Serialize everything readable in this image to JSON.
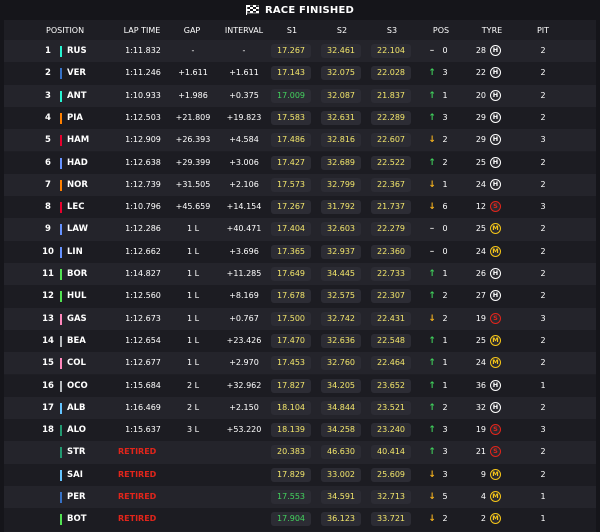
{
  "title": "RACE FINISHED",
  "columns": {
    "position": "POSITION",
    "lap_time": "LAP TIME",
    "gap": "GAP",
    "interval": "INTERVAL",
    "s1": "S1",
    "s2": "S2",
    "s3": "S3",
    "pos": "POS",
    "tyre": "TYRE",
    "pit": "PIT"
  },
  "colors": {
    "mercedes": "#27f4d2",
    "red_bull": "#3671c6",
    "mclaren": "#ff8000",
    "ferrari": "#e8002d",
    "racing_bulls": "#6692ff",
    "haas": "#b6babd",
    "alpine": "#ff87bc",
    "williams": "#64c4ff",
    "sauber": "#52e252",
    "aston_martin": "#229971",
    "sector_yellow": "#f3e66b",
    "sector_green": "#43d35e",
    "retired": "#e1251b"
  },
  "rows": [
    {
      "pos": "1",
      "code": "RUS",
      "team": "mercedes",
      "lap": "1:11.832",
      "gap": "-",
      "int": "-",
      "s1": "17.267",
      "s1c": "y",
      "s2": "32.461",
      "s2c": "y",
      "s3": "22.104",
      "s3c": "y",
      "dir": "flat",
      "chg": "0",
      "laps": "28",
      "tyre": "H",
      "pit": "2"
    },
    {
      "pos": "2",
      "code": "VER",
      "team": "red_bull",
      "lap": "1:11.246",
      "gap": "+1.611",
      "int": "+1.611",
      "s1": "17.143",
      "s1c": "y",
      "s2": "32.075",
      "s2c": "y",
      "s3": "22.028",
      "s3c": "y",
      "dir": "up",
      "chg": "3",
      "laps": "22",
      "tyre": "H",
      "pit": "2"
    },
    {
      "pos": "3",
      "code": "ANT",
      "team": "mercedes",
      "lap": "1:10.933",
      "gap": "+1.986",
      "int": "+0.375",
      "s1": "17.009",
      "s1c": "g",
      "s2": "32.087",
      "s2c": "y",
      "s3": "21.837",
      "s3c": "y",
      "dir": "up",
      "chg": "1",
      "laps": "20",
      "tyre": "H",
      "pit": "2"
    },
    {
      "pos": "4",
      "code": "PIA",
      "team": "mclaren",
      "lap": "1:12.503",
      "gap": "+21.809",
      "int": "+19.823",
      "s1": "17.583",
      "s1c": "y",
      "s2": "32.631",
      "s2c": "y",
      "s3": "22.289",
      "s3c": "y",
      "dir": "up",
      "chg": "3",
      "laps": "29",
      "tyre": "H",
      "pit": "2"
    },
    {
      "pos": "5",
      "code": "HAM",
      "team": "ferrari",
      "lap": "1:12.909",
      "gap": "+26.393",
      "int": "+4.584",
      "s1": "17.486",
      "s1c": "y",
      "s2": "32.816",
      "s2c": "y",
      "s3": "22.607",
      "s3c": "y",
      "dir": "down",
      "chg": "2",
      "laps": "29",
      "tyre": "H",
      "pit": "3"
    },
    {
      "pos": "6",
      "code": "HAD",
      "team": "racing_bulls",
      "lap": "1:12.638",
      "gap": "+29.399",
      "int": "+3.006",
      "s1": "17.427",
      "s1c": "y",
      "s2": "32.689",
      "s2c": "y",
      "s3": "22.522",
      "s3c": "y",
      "dir": "up",
      "chg": "2",
      "laps": "25",
      "tyre": "H",
      "pit": "2"
    },
    {
      "pos": "7",
      "code": "NOR",
      "team": "mclaren",
      "lap": "1:12.739",
      "gap": "+31.505",
      "int": "+2.106",
      "s1": "17.573",
      "s1c": "y",
      "s2": "32.799",
      "s2c": "y",
      "s3": "22.367",
      "s3c": "y",
      "dir": "down",
      "chg": "1",
      "laps": "24",
      "tyre": "H",
      "pit": "2"
    },
    {
      "pos": "8",
      "code": "LEC",
      "team": "ferrari",
      "lap": "1:10.796",
      "gap": "+45.659",
      "int": "+14.154",
      "s1": "17.267",
      "s1c": "y",
      "s2": "31.792",
      "s2c": "y",
      "s3": "21.737",
      "s3c": "y",
      "dir": "down",
      "chg": "6",
      "laps": "12",
      "tyre": "S",
      "pit": "3"
    },
    {
      "pos": "9",
      "code": "LAW",
      "team": "racing_bulls",
      "lap": "1:12.286",
      "gap": "1 L",
      "int": "+40.471",
      "s1": "17.404",
      "s1c": "y",
      "s2": "32.603",
      "s2c": "y",
      "s3": "22.279",
      "s3c": "y",
      "dir": "flat",
      "chg": "0",
      "laps": "25",
      "tyre": "M",
      "pit": "2"
    },
    {
      "pos": "10",
      "code": "LIN",
      "team": "racing_bulls",
      "lap": "1:12.662",
      "gap": "1 L",
      "int": "+3.696",
      "s1": "17.365",
      "s1c": "y",
      "s2": "32.937",
      "s2c": "y",
      "s3": "22.360",
      "s3c": "y",
      "dir": "flat",
      "chg": "0",
      "laps": "24",
      "tyre": "M",
      "pit": "2"
    },
    {
      "pos": "11",
      "code": "BOR",
      "team": "sauber",
      "lap": "1:14.827",
      "gap": "1 L",
      "int": "+11.285",
      "s1": "17.649",
      "s1c": "y",
      "s2": "34.445",
      "s2c": "y",
      "s3": "22.733",
      "s3c": "y",
      "dir": "up",
      "chg": "1",
      "laps": "26",
      "tyre": "H",
      "pit": "2"
    },
    {
      "pos": "12",
      "code": "HUL",
      "team": "sauber",
      "lap": "1:12.560",
      "gap": "1 L",
      "int": "+8.169",
      "s1": "17.678",
      "s1c": "y",
      "s2": "32.575",
      "s2c": "y",
      "s3": "22.307",
      "s3c": "y",
      "dir": "up",
      "chg": "2",
      "laps": "27",
      "tyre": "H",
      "pit": "2"
    },
    {
      "pos": "13",
      "code": "GAS",
      "team": "alpine",
      "lap": "1:12.673",
      "gap": "1 L",
      "int": "+0.767",
      "s1": "17.500",
      "s1c": "y",
      "s2": "32.742",
      "s2c": "y",
      "s3": "22.431",
      "s3c": "y",
      "dir": "down",
      "chg": "2",
      "laps": "19",
      "tyre": "S",
      "pit": "3"
    },
    {
      "pos": "14",
      "code": "BEA",
      "team": "haas",
      "lap": "1:12.654",
      "gap": "1 L",
      "int": "+23.426",
      "s1": "17.470",
      "s1c": "y",
      "s2": "32.636",
      "s2c": "y",
      "s3": "22.548",
      "s3c": "y",
      "dir": "up",
      "chg": "1",
      "laps": "25",
      "tyre": "M",
      "pit": "2"
    },
    {
      "pos": "15",
      "code": "COL",
      "team": "alpine",
      "lap": "1:12.677",
      "gap": "1 L",
      "int": "+2.970",
      "s1": "17.453",
      "s1c": "y",
      "s2": "32.760",
      "s2c": "y",
      "s3": "22.464",
      "s3c": "y",
      "dir": "up",
      "chg": "1",
      "laps": "24",
      "tyre": "M",
      "pit": "2"
    },
    {
      "pos": "16",
      "code": "OCO",
      "team": "haas",
      "lap": "1:15.684",
      "gap": "2 L",
      "int": "+32.962",
      "s1": "17.827",
      "s1c": "y",
      "s2": "34.205",
      "s2c": "y",
      "s3": "23.652",
      "s3c": "y",
      "dir": "up",
      "chg": "1",
      "laps": "36",
      "tyre": "H",
      "pit": "1"
    },
    {
      "pos": "17",
      "code": "ALB",
      "team": "williams",
      "lap": "1:16.469",
      "gap": "2 L",
      "int": "+2.150",
      "s1": "18.104",
      "s1c": "y",
      "s2": "34.844",
      "s2c": "y",
      "s3": "23.521",
      "s3c": "y",
      "dir": "up",
      "chg": "2",
      "laps": "32",
      "tyre": "H",
      "pit": "2"
    },
    {
      "pos": "18",
      "code": "ALO",
      "team": "aston_martin",
      "lap": "1:15.637",
      "gap": "3 L",
      "int": "+53.220",
      "s1": "18.139",
      "s1c": "y",
      "s2": "34.258",
      "s2c": "y",
      "s3": "23.240",
      "s3c": "y",
      "dir": "up",
      "chg": "3",
      "laps": "19",
      "tyre": "S",
      "pit": "3"
    },
    {
      "pos": "",
      "code": "STR",
      "team": "aston_martin",
      "status": "RETIRED",
      "s1": "20.383",
      "s1c": "y",
      "s2": "46.630",
      "s2c": "y",
      "s3": "40.414",
      "s3c": "y",
      "dir": "up",
      "chg": "3",
      "laps": "21",
      "tyre": "S",
      "pit": "2"
    },
    {
      "pos": "",
      "code": "SAI",
      "team": "williams",
      "status": "RETIRED",
      "s1": "17.829",
      "s1c": "y",
      "s2": "33.002",
      "s2c": "y",
      "s3": "25.609",
      "s3c": "y",
      "dir": "down",
      "chg": "3",
      "laps": "9",
      "tyre": "M",
      "pit": "2"
    },
    {
      "pos": "",
      "code": "PER",
      "team": "red_bull",
      "status": "RETIRED",
      "s1": "17.553",
      "s1c": "g",
      "s2": "34.591",
      "s2c": "y",
      "s3": "32.713",
      "s3c": "y",
      "dir": "down",
      "chg": "5",
      "laps": "4",
      "tyre": "M",
      "pit": "1"
    },
    {
      "pos": "",
      "code": "BOT",
      "team": "sauber",
      "status": "RETIRED",
      "s1": "17.904",
      "s1c": "g",
      "s2": "36.123",
      "s2c": "y",
      "s3": "33.721",
      "s3c": "y",
      "dir": "down",
      "chg": "2",
      "laps": "2",
      "tyre": "M",
      "pit": "1"
    }
  ]
}
